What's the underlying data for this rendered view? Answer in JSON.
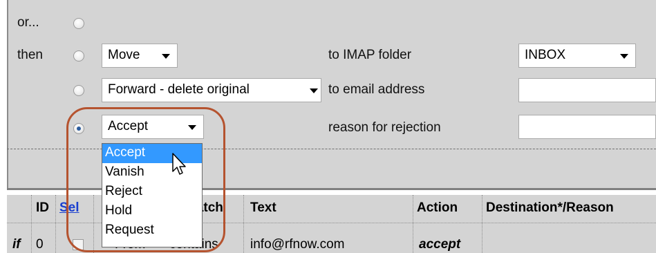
{
  "rows": {
    "or_label": "or...",
    "then_label": "then",
    "move_select": "Move",
    "forward_select": "Forward - delete original",
    "action_select": "Accept",
    "to_imap_folder": "to IMAP folder",
    "to_email_address": "to email address",
    "reason_for_rejection": "reason for rejection",
    "folder_select": "INBOX"
  },
  "dropdown": {
    "options": [
      "Accept",
      "Vanish",
      "Reject",
      "Hold",
      "Request"
    ],
    "selected_index": 0
  },
  "table": {
    "headers": [
      "ID",
      "Sel",
      "Match",
      "Text",
      "Action",
      "Destination*/Reason"
    ],
    "row": {
      "prefix": "if",
      "id": "0",
      "field": "From",
      "match": "contains",
      "text": "info@rfnow.com",
      "action": "accept"
    }
  },
  "colors": {
    "panel_bg": "#d4d4d4",
    "highlight": "#b5532f",
    "selected_option": "#3399ff",
    "link": "#1a3fcf"
  },
  "icons": [
    "mouse-cursor-icon",
    "chevron-down-icon",
    "radio-button-icon",
    "checkbox-icon"
  ]
}
